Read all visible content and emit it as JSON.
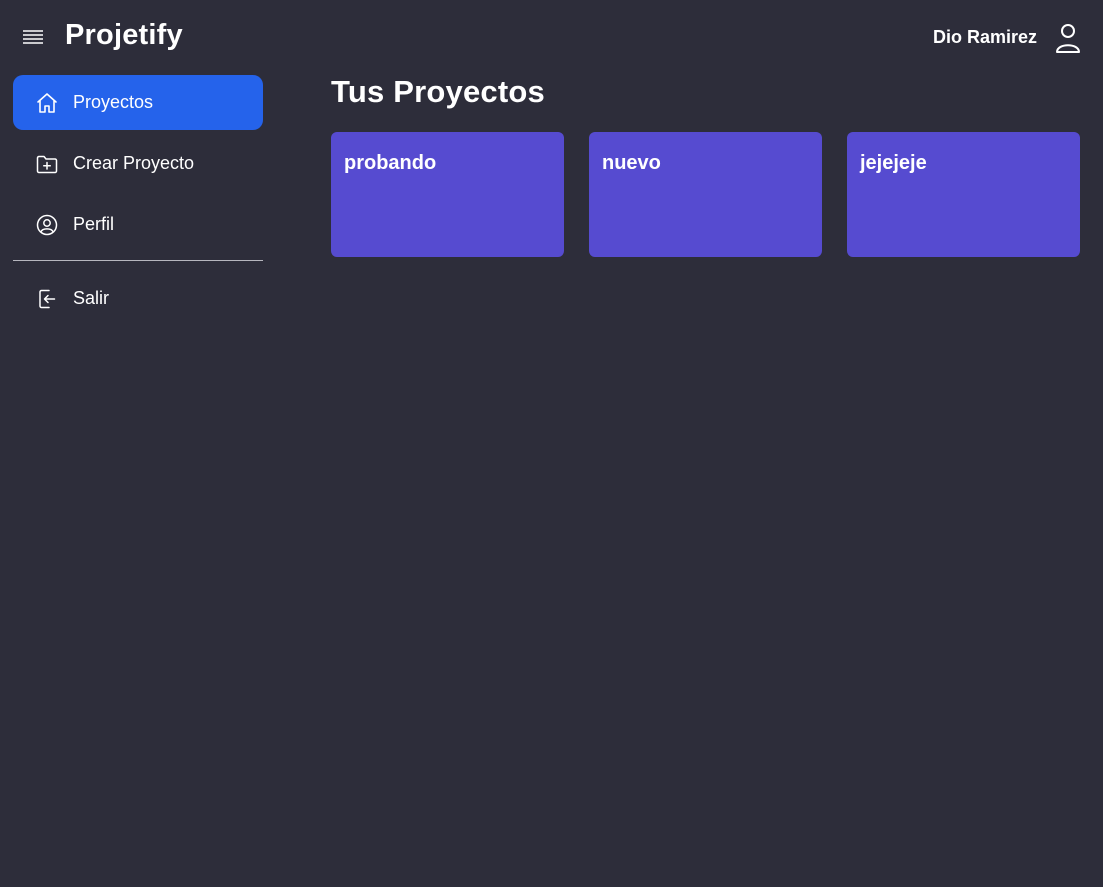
{
  "header": {
    "app_title": "Projetify",
    "user_name": "Dio Ramirez",
    "menu_icon": "hamburger-menu-icon",
    "avatar_icon": "user-outline-icon"
  },
  "sidebar": {
    "items": [
      {
        "label": "Proyectos",
        "icon": "home-icon",
        "active": true
      },
      {
        "label": "Crear Proyecto",
        "icon": "folder-plus-icon",
        "active": false
      },
      {
        "label": "Perfil",
        "icon": "user-circle-icon",
        "active": false
      }
    ],
    "logout": {
      "label": "Salir",
      "icon": "logout-icon"
    }
  },
  "main": {
    "title": "Tus Proyectos",
    "projects": [
      {
        "name": "probando"
      },
      {
        "name": "nuevo"
      },
      {
        "name": "jejejeje"
      }
    ]
  },
  "colors": {
    "background": "#2d2d3a",
    "accent": "#2563eb",
    "card": "#564bd0",
    "text": "#ffffff"
  }
}
